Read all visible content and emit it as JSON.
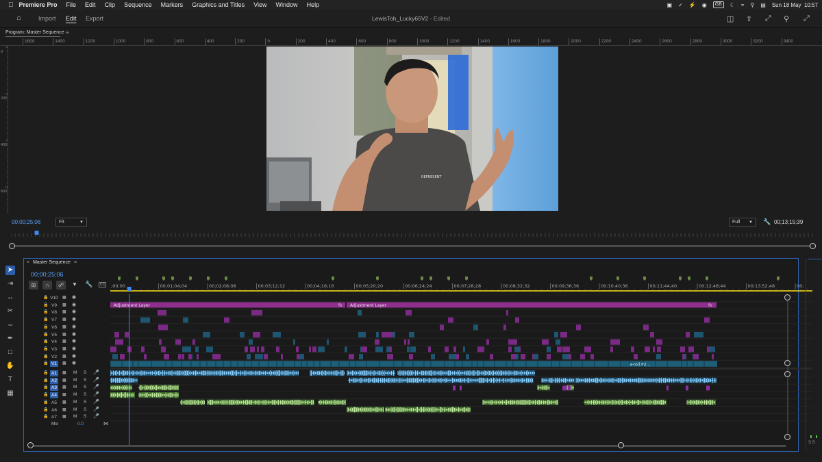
{
  "menubar": {
    "app": "Premiere Pro",
    "items": [
      "File",
      "Edit",
      "Clip",
      "Sequence",
      "Markers",
      "Graphics and Titles",
      "View",
      "Window",
      "Help"
    ],
    "keyboard": "GB",
    "datetime": "Sun 18 May  10:57"
  },
  "workspace": {
    "tabs": [
      "Import",
      "Edit",
      "Export"
    ],
    "active": "Edit",
    "title": "LewisToh_Lucky65V2",
    "status": " - Edited"
  },
  "program": {
    "title": "Program: Master Sequence",
    "ruler_labels": [
      "1600",
      "1400",
      "1200",
      "1000",
      "800",
      "600",
      "400",
      "200",
      "0",
      "200",
      "400",
      "600",
      "800",
      "1000",
      "1200",
      "1400",
      "1600",
      "1800",
      "2000",
      "2200",
      "2400",
      "2600",
      "2800",
      "3000",
      "3200",
      "3400"
    ],
    "vruler_labels": [
      "0",
      "200",
      "400",
      "600"
    ],
    "timecode": "00;00;25;06",
    "fit": "Fit",
    "resolution": "Full",
    "duration": "00;13;15;39",
    "playhead": 0.032
  },
  "timeline": {
    "title": "Master Sequence",
    "timecode": "00;00;25;06",
    "ruler_labels": [
      ";00;00",
      "00;01;04;04",
      "00;02;08;08",
      "00;03;12;12",
      "00;04;16;16",
      "00;05;20;20",
      "00;06;24;24",
      "00;07;28;28",
      "00;08;32;32",
      "00;09;36;36",
      "00;10;40;36",
      "00;11;44;40",
      "00;12;48;44",
      "00;13;52;48",
      "00;"
    ],
    "video_tracks": [
      "V10",
      "V9",
      "V8",
      "V7",
      "V6",
      "V5",
      "V4",
      "V3",
      "V2",
      "V1"
    ],
    "audio_tracks": [
      "A1",
      "A2",
      "A3",
      "A4",
      "A5",
      "A6",
      "A7"
    ],
    "highlighted_tracks": [
      "V1",
      "A1",
      "A2",
      "A3",
      "A4"
    ],
    "adjustment_label": "Adjustment Layer",
    "aroll_label": "a-roll P2...",
    "fx_label": "fx",
    "mix_label": "Mix",
    "mix_value": "0.0",
    "track_btn_m": "M",
    "track_btn_s": "S",
    "playhead": 0.027
  },
  "right_panel": {
    "label": "S S"
  },
  "colors": {
    "accent": "#2f63b5",
    "adjustment": "#8e2f8d",
    "v1": "#1d5f78",
    "audio_blue": "#4aa6e0",
    "audio_green": "#3c6b28",
    "clip_purple": "#7a2a85"
  },
  "icons": [
    "apple-icon",
    "home-icon",
    "search-icon",
    "wrench-icon",
    "select-tool-icon",
    "track-select-icon",
    "ripple-edit-icon",
    "razor-icon",
    "slip-icon",
    "pen-icon",
    "rectangle-icon",
    "hand-icon",
    "type-icon",
    "eye-icon",
    "lock-icon",
    "microphone-icon"
  ]
}
